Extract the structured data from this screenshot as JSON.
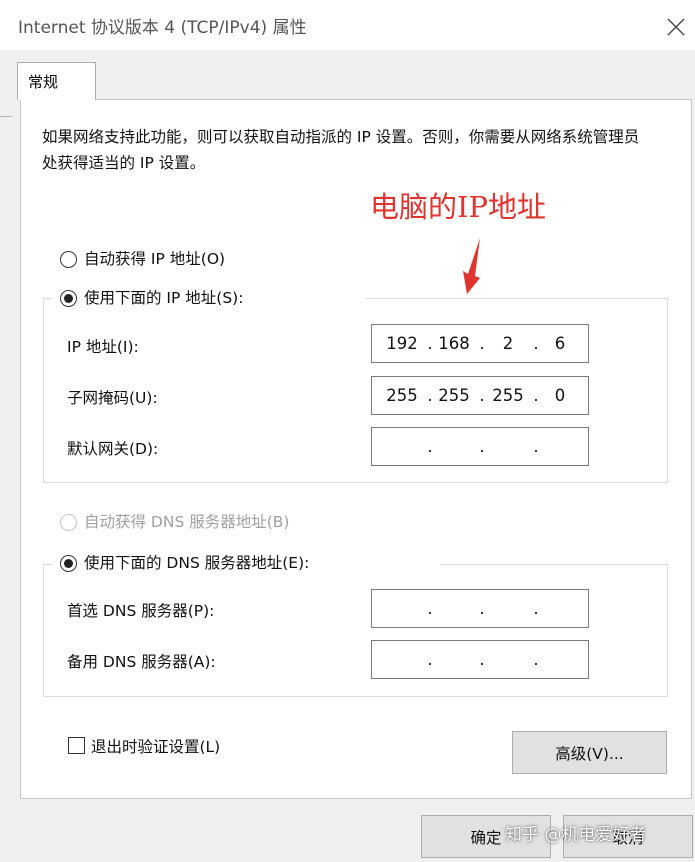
{
  "window": {
    "title": "Internet 协议版本 4 (TCP/IPv4) 属性",
    "close_icon": "close-icon"
  },
  "tabs": [
    {
      "label": "常规",
      "selected": true
    }
  ],
  "description": "如果网络支持此功能，则可以获取自动指派的 IP 设置。否则，你需要从网络系统管理员处获得适当的 IP 设置。",
  "annotation": {
    "text": "电脑的IP地址",
    "color": "#e0342f"
  },
  "ip_section": {
    "auto_label": "自动获得 IP 地址(O)",
    "manual_label": "使用下面的 IP 地址(S):",
    "selected": "manual",
    "fields": [
      {
        "label": "IP 地址(I):",
        "octets": [
          "192",
          "168",
          "2",
          "6"
        ]
      },
      {
        "label": "子网掩码(U):",
        "octets": [
          "255",
          "255",
          "255",
          "0"
        ]
      },
      {
        "label": "默认网关(D):",
        "octets": [
          "",
          "",
          "",
          ""
        ]
      }
    ]
  },
  "dns_section": {
    "auto_label": "自动获得 DNS 服务器地址(B)",
    "auto_disabled": true,
    "manual_label": "使用下面的 DNS 服务器地址(E):",
    "selected": "manual",
    "fields": [
      {
        "label": "首选 DNS 服务器(P):",
        "octets": [
          "",
          "",
          "",
          ""
        ]
      },
      {
        "label": "备用 DNS 服务器(A):",
        "octets": [
          "",
          "",
          "",
          ""
        ]
      }
    ]
  },
  "validate_checkbox": {
    "label": "退出时验证设置(L)",
    "checked": false
  },
  "buttons": {
    "advanced": "高级(V)...",
    "ok": "确定",
    "cancel": "取消"
  },
  "watermark": "知乎 @机电爱好者"
}
